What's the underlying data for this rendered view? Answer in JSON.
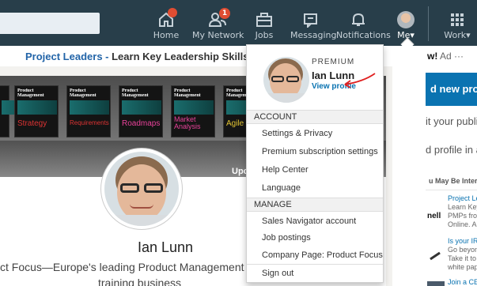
{
  "nav": {
    "items": [
      {
        "label": "Home",
        "icon": "home-icon",
        "badge": "●"
      },
      {
        "label": "My Network",
        "icon": "network-icon",
        "badge": "1"
      },
      {
        "label": "Jobs",
        "icon": "briefcase-icon"
      },
      {
        "label": "Messaging",
        "icon": "messaging-icon"
      },
      {
        "label": "Notifications",
        "icon": "bell-icon"
      },
      {
        "label": "Me",
        "icon": "avatar-icon"
      },
      {
        "label": "Work",
        "icon": "grid-icon"
      }
    ],
    "caret": "▾"
  },
  "ad": {
    "left_blue": "Project Leaders - ",
    "left_dark": "Learn Key Leadership Skills for PM",
    "right_bold": "w!",
    "right_tag": "Ad",
    "right_more": "···"
  },
  "banner": {
    "magazines": [
      {
        "title": "Product Management",
        "word": "Strategy",
        "color": "red"
      },
      {
        "title": "Product Management",
        "word": "Requirements",
        "color": "red"
      },
      {
        "title": "Product Management",
        "word": "Roadmaps",
        "color": "pink"
      },
      {
        "title": "Product Management",
        "word": "Market Analysis",
        "color": "pink"
      },
      {
        "title": "Product Management",
        "word": "Agile",
        "color": "yellow"
      }
    ],
    "update_text": "Upo"
  },
  "profile": {
    "name": "Ian Lunn",
    "headline_line1": "ct Focus—Europe's leading Product Management a",
    "headline_line2": "training business"
  },
  "right": {
    "button": "d new profile",
    "text1": "it your public",
    "text2": "d profile in a",
    "heading": "u May Be Intere",
    "ads": [
      {
        "title": "Project Lea",
        "lines": [
          "Learn Key",
          "PMPs from",
          "Online. App"
        ],
        "logo": "nell"
      },
      {
        "title": "Is your IR p",
        "lines": [
          "Go beyond",
          "Take it to th",
          "white pape"
        ],
        "logo": ""
      },
      {
        "title": "Join a CEO",
        "lines": [],
        "logo": ""
      }
    ]
  },
  "dropdown": {
    "premium": "PREMIUM",
    "name": "Ian Lunn",
    "view_profile": "View profile",
    "account_header": "ACCOUNT",
    "account_items": [
      "Settings & Privacy",
      "Premium subscription settings",
      "Help Center",
      "Language"
    ],
    "manage_header": "MANAGE",
    "manage_items": [
      "Sales Navigator account",
      "Job postings",
      "Company Page: Product Focus"
    ],
    "sign_out": "Sign out"
  },
  "colors": {
    "nav_bg": "#283e4a",
    "link_blue": "#0a73b1",
    "badge_red": "#e04d32",
    "annotation_red": "#e02020"
  }
}
